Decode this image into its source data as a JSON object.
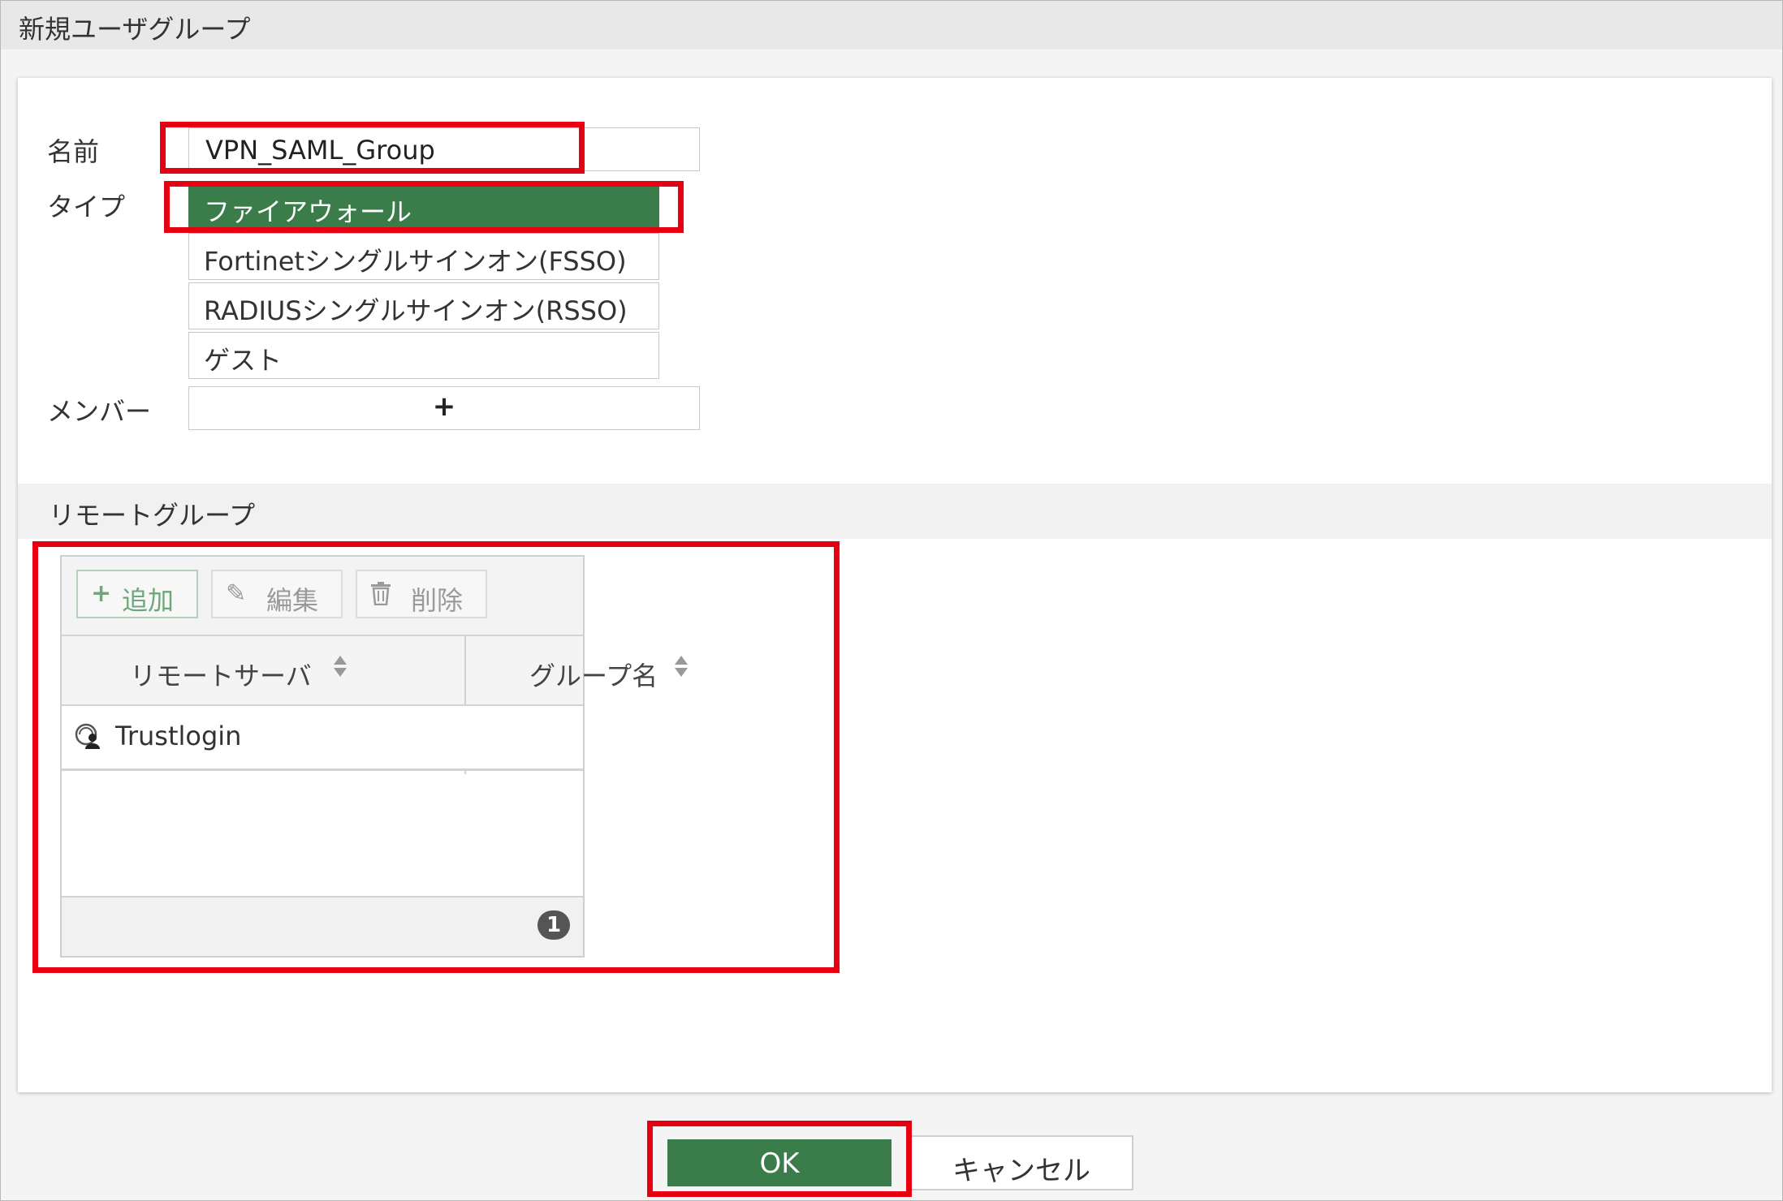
{
  "dialog": {
    "title": "新規ユーザグループ"
  },
  "form": {
    "name_label": "名前",
    "name_value": "VPN_SAML_Group",
    "type_label": "タイプ",
    "type_options": [
      "ファイアウォール",
      "Fortinetシングルサインオン(FSSO)",
      "RADIUSシングルサインオン(RSSO)",
      "ゲスト"
    ],
    "type_selected": "ファイアウォール",
    "member_label": "メンバー",
    "member_add": "+"
  },
  "remote_groups": {
    "section_title": "リモートグループ",
    "toolbar": {
      "add": "追加",
      "edit": "編集",
      "delete": "削除"
    },
    "columns": [
      "リモートサーバ",
      "グループ名"
    ],
    "rows": [
      {
        "remote_server": "Trustlogin",
        "group_name": ""
      }
    ],
    "count": "1"
  },
  "footer": {
    "ok": "OK",
    "cancel": "キャンセル"
  },
  "colors": {
    "accent": "#3b7d4a",
    "highlight": "#e60012"
  },
  "icons": {
    "add": "plus-icon",
    "edit": "pencil-icon",
    "delete": "trash-icon",
    "server": "saml-server-icon"
  }
}
